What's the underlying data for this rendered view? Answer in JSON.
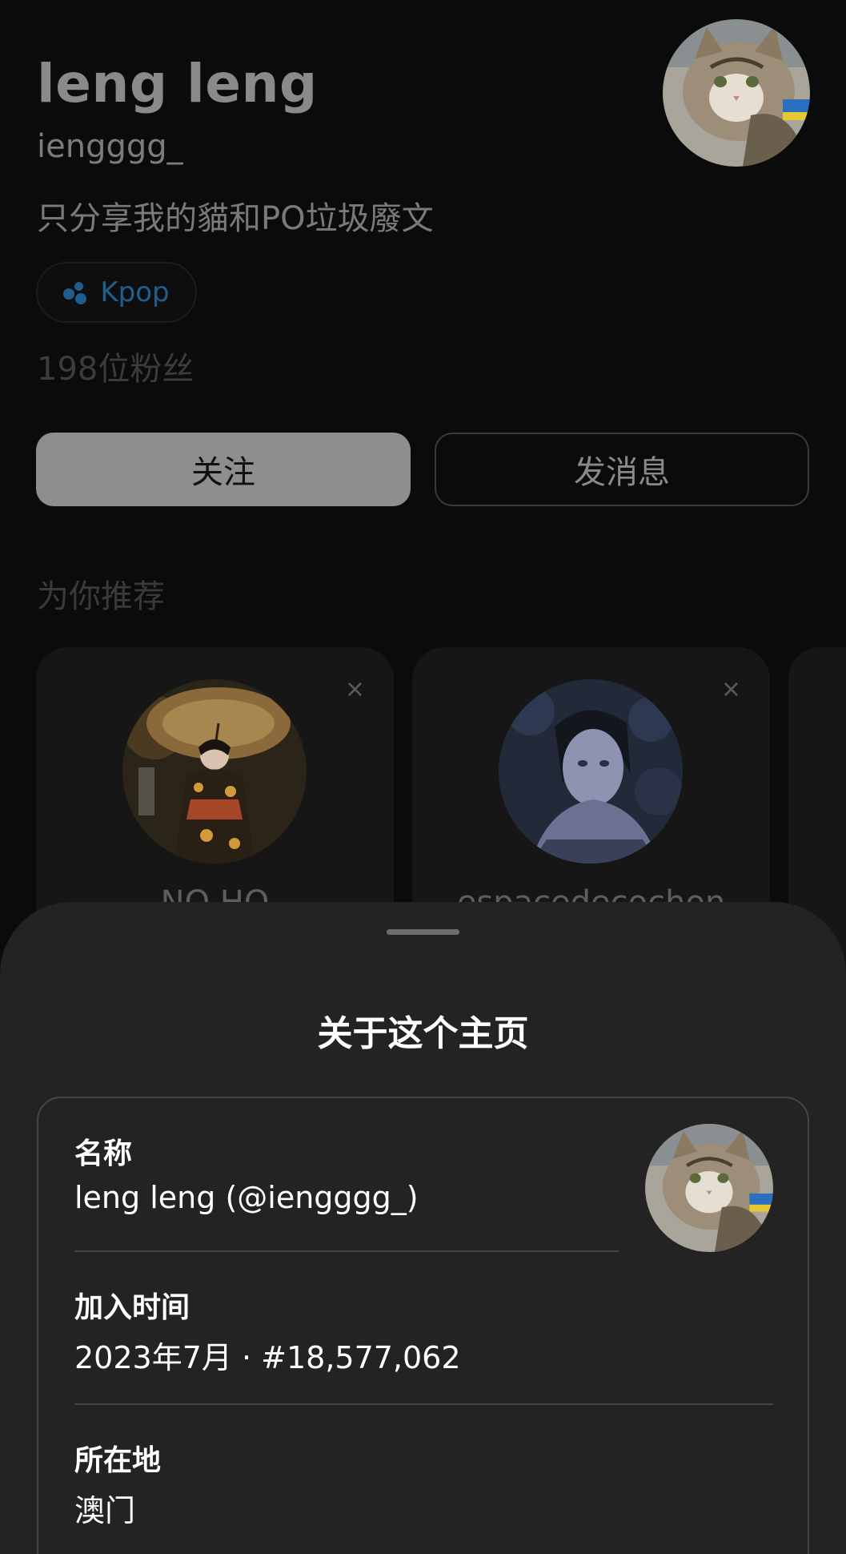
{
  "profile": {
    "name": "leng leng",
    "handle": "iengggg_",
    "bio": "只分享我的貓和PO垃圾廢文",
    "tag": {
      "label": "Kpop",
      "icon": "threads-topic-icon"
    },
    "followers": "198位粉丝",
    "follow_label": "关注",
    "message_label": "发消息",
    "recommend_title": "为你推荐"
  },
  "recommendations": [
    {
      "name": "NO HO",
      "close": "×"
    },
    {
      "name": "espacedecochon",
      "close": "×"
    }
  ],
  "sheet": {
    "title": "关于这个主页",
    "name_label": "名称",
    "name_value": "leng leng (@iengggg_)",
    "joined_label": "加入时间",
    "joined_value": "2023年7月 · #18,577,062",
    "location_label": "所在地",
    "location_value": "澳门"
  },
  "colors": {
    "background": "#0b0b0b",
    "sheet": "#232323",
    "tag_accent": "#1f5f90",
    "follow_button": "#8e8e8e"
  }
}
